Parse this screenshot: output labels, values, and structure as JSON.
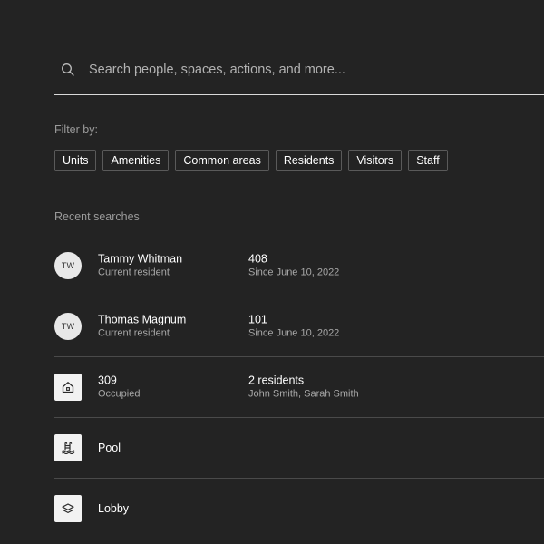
{
  "search": {
    "placeholder": "Search people, spaces, actions, and more...",
    "value": ""
  },
  "filters": {
    "label": "Filter by:",
    "chips": [
      "Units",
      "Amenities",
      "Common areas",
      "Residents",
      "Visitors",
      "Staff"
    ]
  },
  "recent": {
    "label": "Recent searches",
    "items": [
      {
        "icon": "avatar",
        "initials": "TW",
        "title": "Tammy Whitman",
        "subtitle": "Current resident",
        "detail_title": "408",
        "detail_subtitle": "Since June 10, 2022"
      },
      {
        "icon": "avatar",
        "initials": "TW",
        "title": "Thomas Magnum",
        "subtitle": "Current resident",
        "detail_title": "101",
        "detail_subtitle": "Since June 10, 2022"
      },
      {
        "icon": "home-icon",
        "title": "309",
        "subtitle": "Occupied",
        "detail_title": "2 residents",
        "detail_subtitle": "John Smith, Sarah Smith"
      },
      {
        "icon": "pool-icon",
        "title": "Pool"
      },
      {
        "icon": "layers-icon",
        "title": "Lobby"
      }
    ]
  },
  "colors": {
    "background": "#232323",
    "text": "#ffffff",
    "muted": "#9a9a9a",
    "divider": "#4a4a4a"
  }
}
